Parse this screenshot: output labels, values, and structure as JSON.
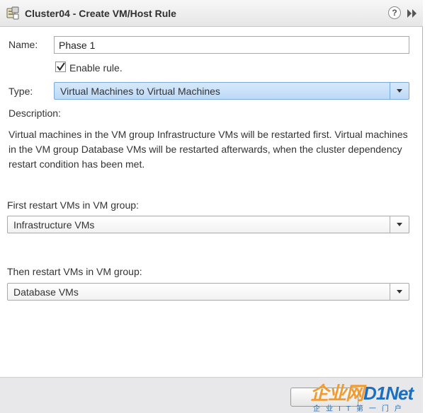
{
  "dialog": {
    "title": "Cluster04 - Create VM/Host Rule",
    "help_glyph": "?"
  },
  "form": {
    "name_label": "Name:",
    "name_value": "Phase 1",
    "enable_label": "Enable rule.",
    "enable_checked": true,
    "type_label": "Type:",
    "type_value": "Virtual Machines to Virtual Machines",
    "description_label": "Description:",
    "description_text": "Virtual machines in the VM group Infrastructure VMs will be restarted first. Virtual machines in the VM group Database VMs will be restarted afterwards, when the cluster dependency restart condition has been met.",
    "first_label": "First restart VMs in VM group:",
    "first_value": "Infrastructure VMs",
    "then_label": "Then restart VMs in VM group:",
    "then_value": "Database VMs"
  },
  "watermark": {
    "text_orange": "企业网",
    "text_blue": "D1Net",
    "subtitle": "企业IT第一门户"
  },
  "colors": {
    "selected_select": "#bcd9f7",
    "footer": "#e8e8ea"
  }
}
